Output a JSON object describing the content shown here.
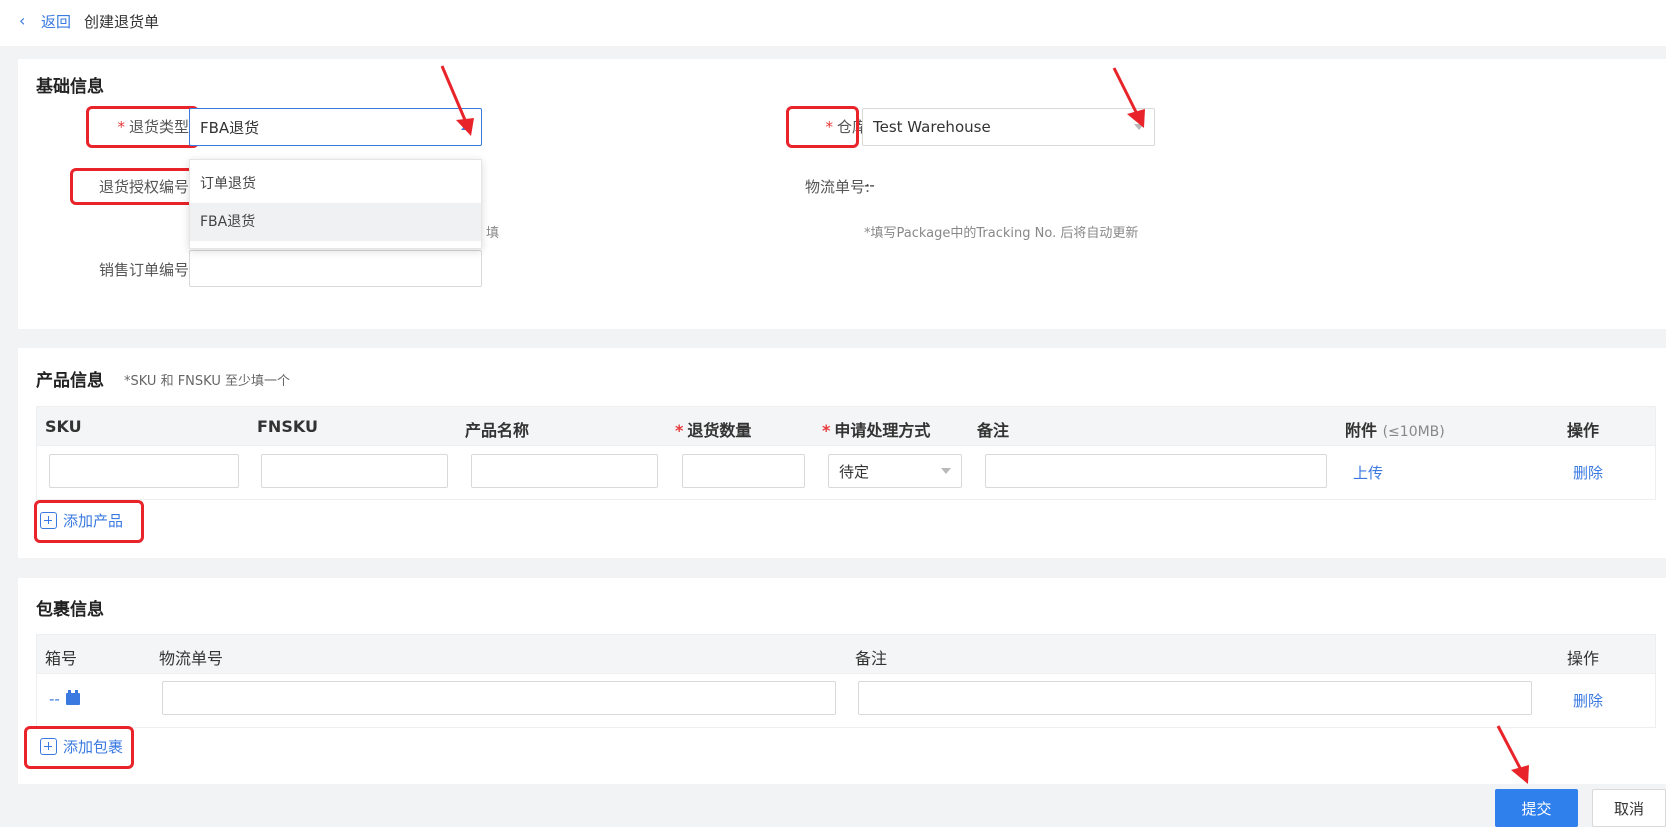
{
  "header": {
    "back_label": "返回",
    "title": "创建退货单"
  },
  "basic": {
    "section_title": "基础信息",
    "return_type": {
      "required_mark": "*",
      "label": "退货类型:",
      "value": "FBA退货",
      "options": [
        "订单退货",
        "FBA退货"
      ],
      "selected_index": 1,
      "open": true
    },
    "warehouse": {
      "required_mark": "*",
      "label": "仓库:",
      "value": "Test Warehouse"
    },
    "rma_number": {
      "label": "退货授权编号:",
      "hint_tail": "填"
    },
    "tracking": {
      "label": "物流单号:",
      "value": "--",
      "hint": "*填写Package中的Tracking No. 后将自动更新"
    },
    "sales_order": {
      "label": "销售订单编号:"
    }
  },
  "product": {
    "section_title": "产品信息",
    "hint": "*SKU 和 FNSKU 至少填一个",
    "columns": {
      "sku": "SKU",
      "fnsku": "FNSKU",
      "name": "产品名称",
      "qty_required": "*",
      "qty": "退货数量",
      "method_required": "*",
      "method": "申请处理方式",
      "remark": "备注",
      "attachment": "附件",
      "attachment_limit": "(≤10MB)",
      "action": "操作"
    },
    "rows": [
      {
        "method_value": "待定",
        "upload_label": "上传",
        "delete_label": "删除"
      }
    ],
    "add_label": "添加产品"
  },
  "package": {
    "section_title": "包裹信息",
    "columns": {
      "box_no": "箱号",
      "tracking": "物流单号",
      "remark": "备注",
      "action": "操作"
    },
    "rows": [
      {
        "box_no": "--",
        "delete_label": "删除"
      }
    ],
    "add_label": "添加包裹"
  },
  "footer": {
    "submit_label": "提交",
    "cancel_label": "取消"
  },
  "colors": {
    "accent": "#3a7ae0",
    "primary_button": "#2f80ed",
    "required": "#e6393b",
    "annotation": "#e8242a"
  },
  "icons": [
    "chevron-left-icon",
    "caret-up-icon",
    "caret-down-icon",
    "plus-square-icon",
    "package-box-icon",
    "red-arrow-icon"
  ]
}
